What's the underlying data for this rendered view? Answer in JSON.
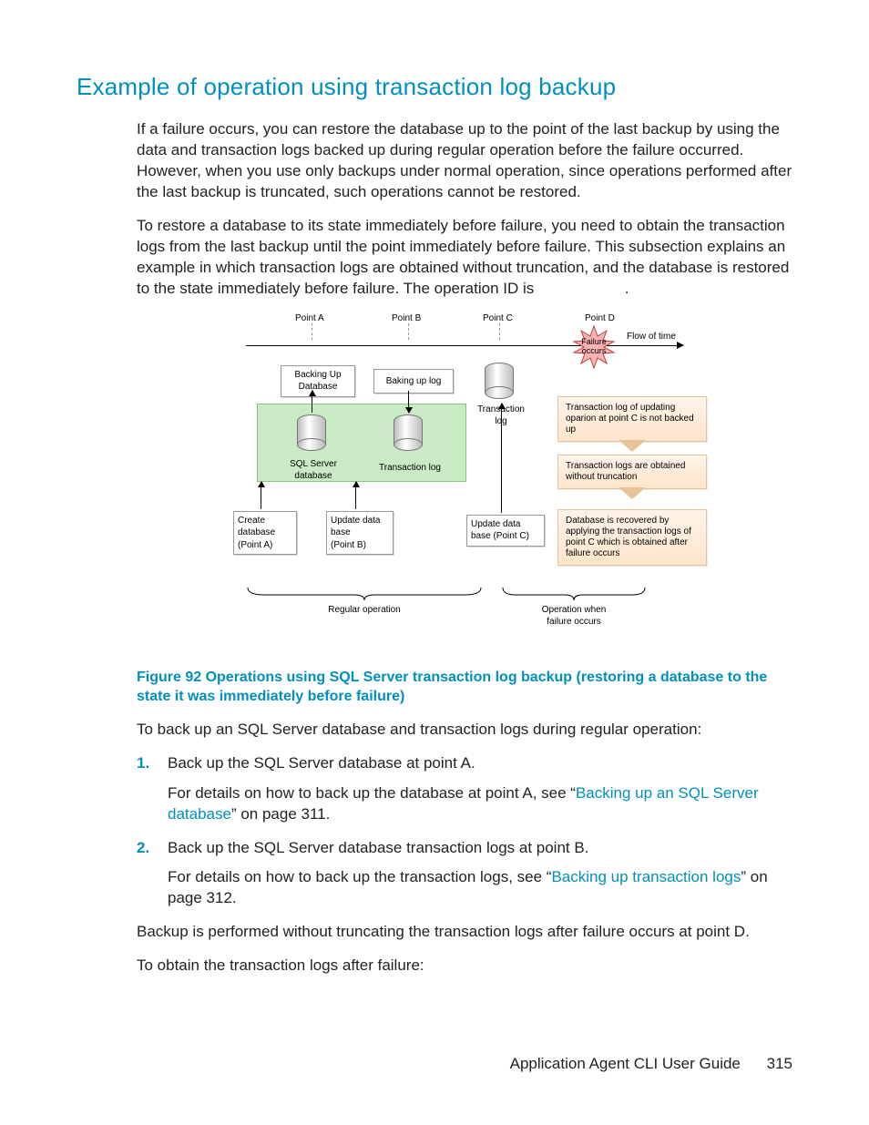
{
  "heading": "Example of operation using transaction log backup",
  "para1": "If a failure occurs, you can restore the database up to the point of the last backup by using the data and transaction logs backed up during regular operation before the failure occurred. However, when you use only backups under normal operation, since operations performed after the last backup is truncated, such operations cannot be restored.",
  "para2": "To restore a database to its state immediately before failure, you need to obtain the transaction logs from the last backup until the point immediately before failure. This subsection explains an example in which transaction logs are obtained without truncation, and the database is restored to the state immediately before failure. The operation ID is ",
  "opid_suffix": ".",
  "caption": "Figure 92 Operations using SQL Server transaction log backup (restoring a database to the state it was immediately before failure)",
  "intro_list": "To back up an SQL Server database and transaction logs during regular operation:",
  "steps": [
    {
      "num": "1.",
      "line": "Back up the SQL Server database at point A.",
      "detail_pre": "For details on how to back up the database at point A, see “",
      "link": "Backing up an SQL Server database",
      "detail_post": "” on page 311."
    },
    {
      "num": "2.",
      "line": "Back up the SQL Server database transaction logs at point B.",
      "detail_pre": "For details on how to back up the transaction logs, see “",
      "link": "Backing up transaction logs",
      "detail_post": "” on page 312."
    }
  ],
  "after1": "Backup is performed without truncating the transaction logs after failure occurs at point D.",
  "after2": "To obtain the transaction logs after failure:",
  "footer_title": "Application Agent CLI User Guide",
  "footer_page": "315",
  "diagram": {
    "pointA": "Point A",
    "pointB": "Point B",
    "pointC": "Point C",
    "pointD": "Point D",
    "flow": "Flow of time",
    "failure": "Failure\noccurs",
    "backupDb": "Backing Up\nDatabase",
    "backupLog": "Baking up log",
    "txLogC": "Transaction\nlog",
    "sqlDb": "SQL Server\ndatabase",
    "txLog": "Transaction log",
    "createDb": "Create\ndatabase\n(Point A)",
    "updateB": "Update data\nbase\n(Point B)",
    "updateC": "Update data\nbase (Point C)",
    "call1": "Transaction log of updating oparion at point C is not backed up",
    "call2": "Transaction logs are obtained without truncation",
    "call3": "Database is recovered by applying the transaction logs of point C which is obtained after failure occurs",
    "braceL": "Regular operation",
    "braceR": "Operation when\nfailure occurs"
  }
}
